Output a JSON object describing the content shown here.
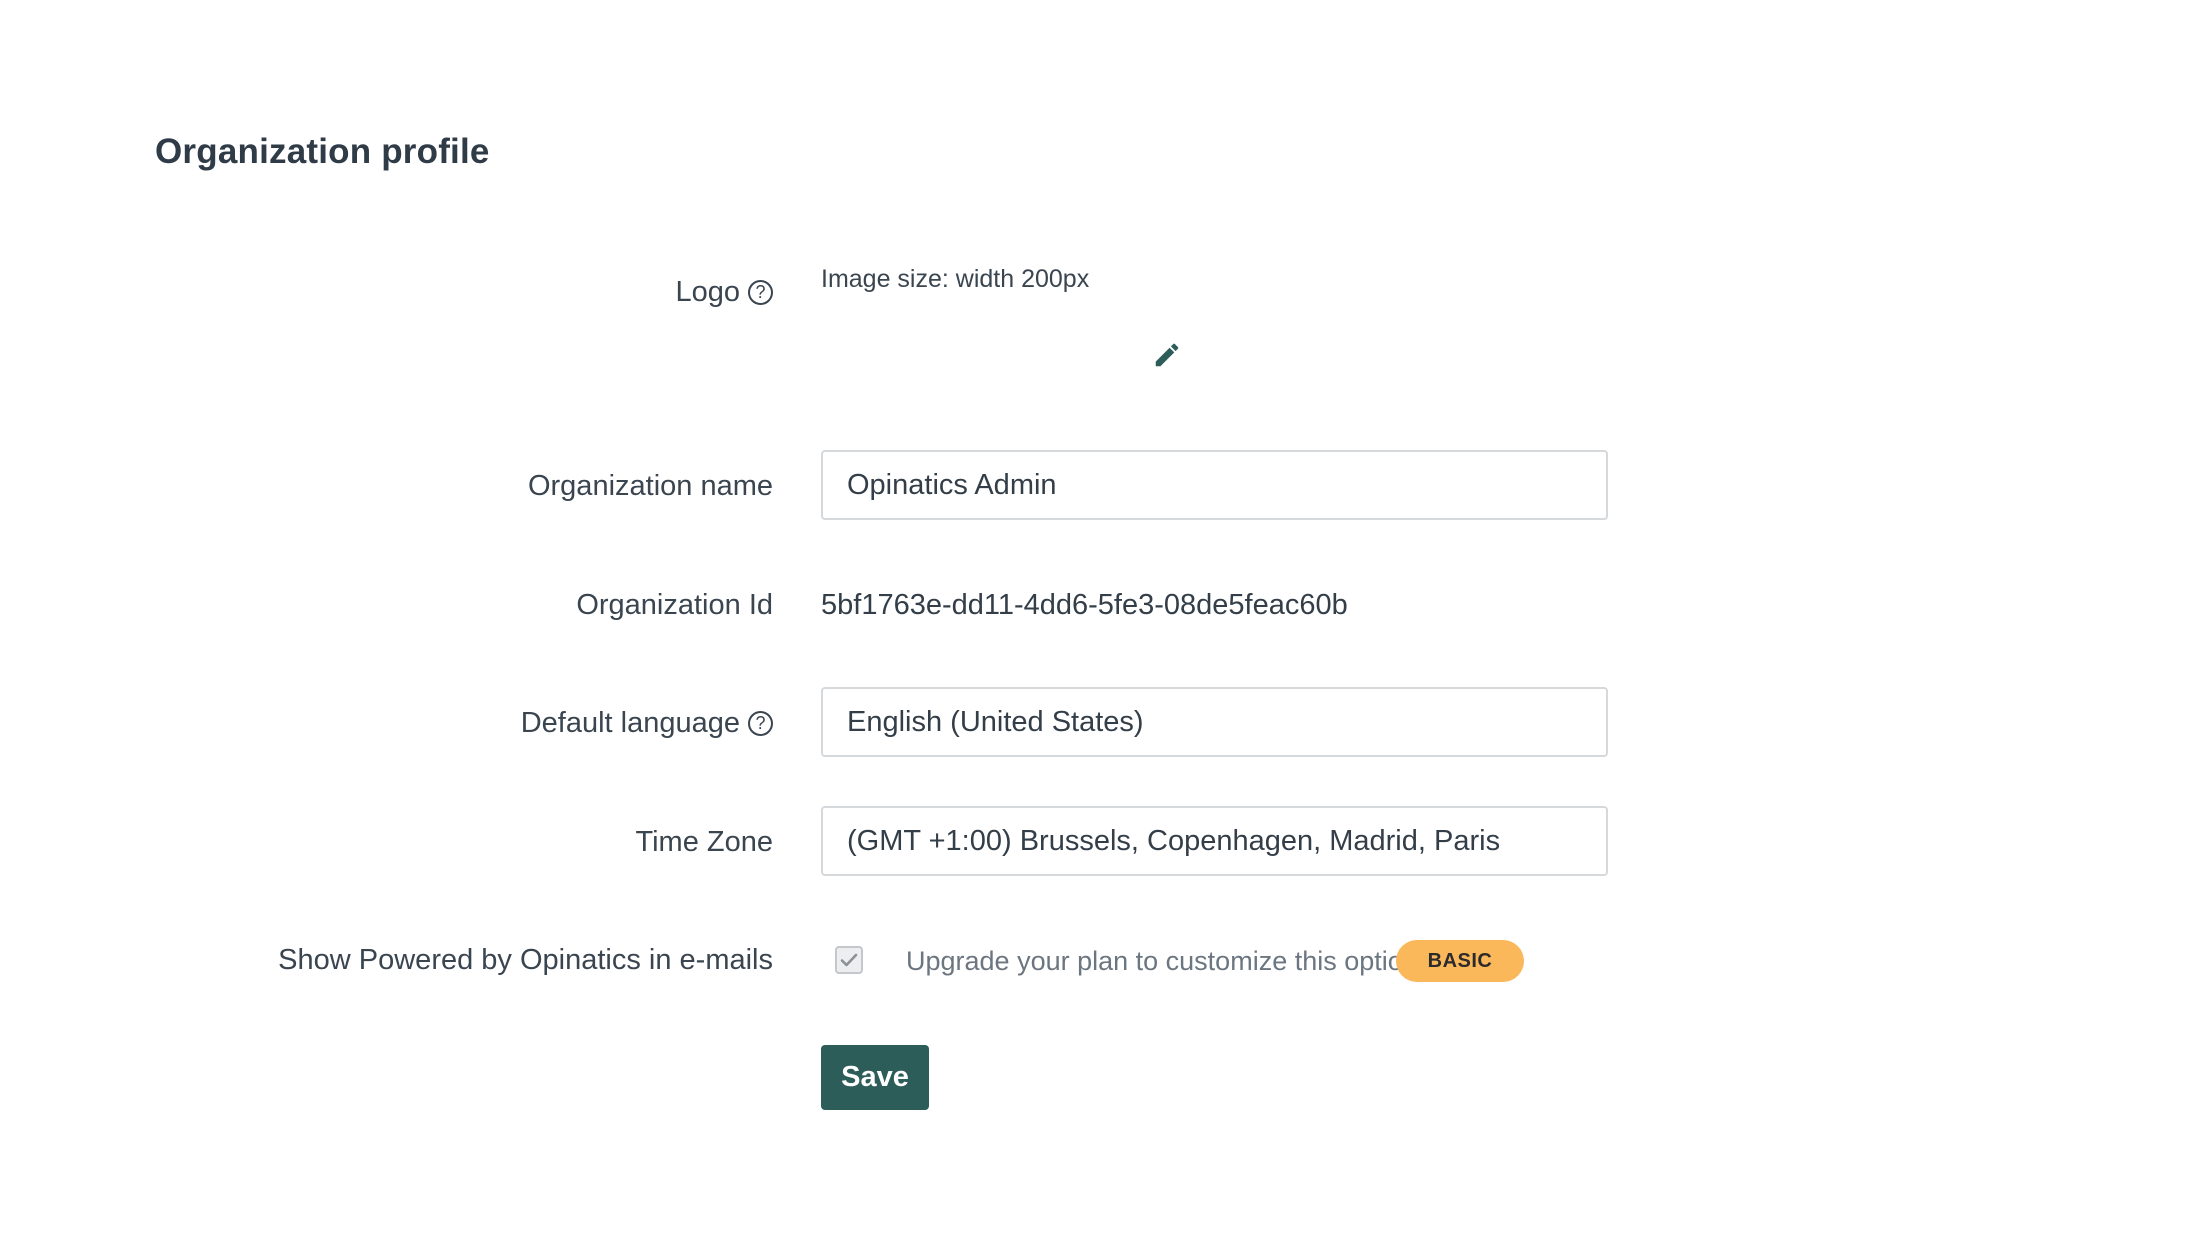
{
  "page": {
    "title": "Organization profile"
  },
  "logo": {
    "label": "Logo",
    "hint": "Image size: width 200px",
    "edit_icon": "pencil-icon"
  },
  "org_name": {
    "label": "Organization name",
    "value": "Opinatics Admin"
  },
  "org_id": {
    "label": "Organization Id",
    "value": "5bf1763e-dd11-4dd6-5fe3-08de5feac60b"
  },
  "language": {
    "label": "Default language",
    "value": "English (United States)"
  },
  "timezone": {
    "label": "Time Zone",
    "value": "(GMT +1:00) Brussels, Copenhagen, Madrid, Paris"
  },
  "powered_by": {
    "label": "Show Powered by Opinatics in e-mails",
    "checked": true,
    "upgrade_text": "Upgrade your plan to customize this option",
    "badge": "BASIC"
  },
  "actions": {
    "save_label": "Save"
  },
  "colors": {
    "primary": "#2d5d59",
    "badge": "#fbb85b",
    "text": "#333e48"
  }
}
